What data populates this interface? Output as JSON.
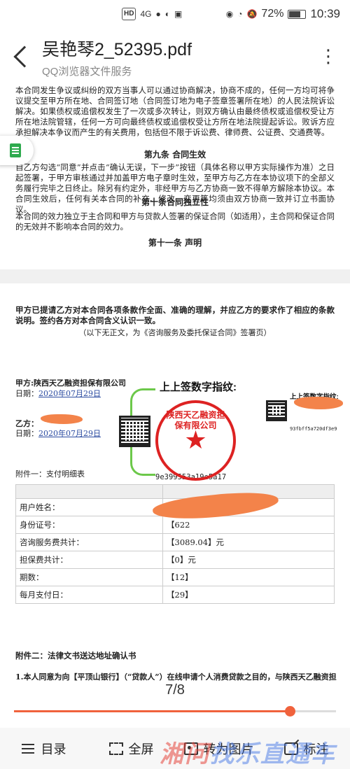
{
  "status_bar": {
    "left_icons": [
      "hd-icon",
      "signal-icon",
      "app-icon",
      "qq-icon",
      "download-icon"
    ],
    "hd": "HD",
    "signal": "4G",
    "battery": "72%",
    "battery_level": 0.72,
    "time": "10:39"
  },
  "header": {
    "title": "吴艳琴2_52395.pdf",
    "subtitle": "QQ浏览器文件服务",
    "more": "⋮"
  },
  "document": {
    "p_top": "本合同发生争议或纠纷的双方当事人可以通过协商解决，协商不成的，任何一方均可将争议提交至甲方所在地、合同签订地（合同签订地为电子签章签署所在地）的人民法院诉讼解决。如果债权或追偿权发生了一次或多次转让，则双方确认由最终债权或追偿权受让方所在地法院管辖，任何一方可向最终债权或追偿权受让方所在地法院提起诉讼。败诉方应承担解决本争议而产生的有关费用，包括但不限于诉讼费、律师费、公证费、交通费等。",
    "h9": "第九条 合同生效",
    "p9": "自乙方勾选“同意”并点击“确认无误，下一步”按钮（具体名称以甲方实际操作为准）之日起签署，于甲方审核通过并加盖甲方电子章时生效，至甲方与乙方在本协议项下的全部义务履行完毕之日终止。除另有约定外，非经甲方与乙方协商一致不得单方解除本协议。本合同生效后，任何有关本合同的补充、修改、变更等均须由双方协商一致并订立书面协议。",
    "h10": "第十条合同独立性",
    "p10": "本合同的效力独立于主合同和甲方与贷款人签署的保证合同（如适用），主合同和保证合同的无效并不影响本合同的效力。",
    "h11": "第十一条 声明",
    "p_decl": "甲方已提请乙方对本合同各项条款作全面、准确的理解，并应乙方的要求作了相应的条款说明。签约各方对本合同含义认识一致。",
    "p_end": "（以下无正文，为《咨询服务及委托保证合同》签署页）",
    "party_a": "甲方:陕西天乙融资担保有限公司",
    "date_label": "日期：",
    "date_a": "2020年07月29日",
    "party_b": "乙方：",
    "date_b": "2020年07月29日",
    "fp_title_left": "上上签数字指纹:",
    "fp_hash_left": "9e399553a19e5a17",
    "fp_title_right": "上上签数字指纹:",
    "fp_hash_right": "93fbff5a720df3e9",
    "seal_text": "陕西天乙融资担保有限公司",
    "seal_star": "★",
    "attach1": "附件一：支付明细表",
    "table_rows": [
      {
        "label": "用户姓名：",
        "value": ""
      },
      {
        "label": "身份证号：",
        "value": "【622"
      },
      {
        "label": "咨询服务费共计：",
        "value": "【3089.04】元"
      },
      {
        "label": "担保费共计：",
        "value": "【0】元"
      },
      {
        "label": "期数：",
        "value": "【12】"
      },
      {
        "label": "每月支付日：",
        "value": "【29】"
      }
    ],
    "attach2": "附件二：法律文书送达地址确认书",
    "p_attach2": "1.本人同意为向【平顶山银行】（“贷款人”）在线申请个人消费贷款之目的，与陕西天乙融资担"
  },
  "pager": {
    "label": "7/8",
    "current": 7,
    "total": 8,
    "progress": 0.857
  },
  "toolbar": {
    "toc": "目录",
    "fullscreen": "全屏",
    "to_image": "转为图片",
    "annotate": "标注"
  },
  "watermark": {
    "part1": "湘问",
    "part2": "找乐直通车"
  }
}
